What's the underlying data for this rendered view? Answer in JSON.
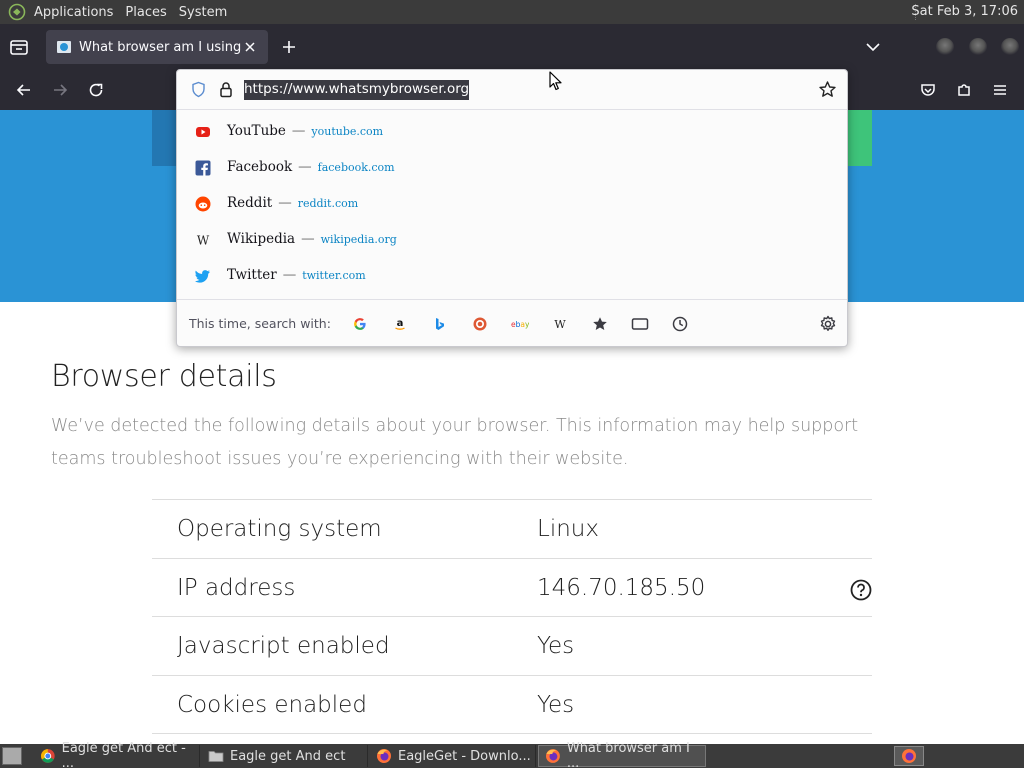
{
  "top_panel": {
    "menus": [
      "Applications",
      "Places",
      "System"
    ],
    "clock": "Sat Feb  3, 17:06"
  },
  "browser": {
    "tab": {
      "title": "What browser am I using?"
    },
    "urlbar": {
      "url": "https://www.whatsmybrowser.org",
      "suggestions": [
        {
          "name": "YouTube",
          "domain": "youtube.com",
          "icon": "youtube-icon"
        },
        {
          "name": "Facebook",
          "domain": "facebook.com",
          "icon": "facebook-icon"
        },
        {
          "name": "Reddit",
          "domain": "reddit.com",
          "icon": "reddit-icon"
        },
        {
          "name": "Wikipedia",
          "domain": "wikipedia.org",
          "icon": "wikipedia-icon"
        },
        {
          "name": "Twitter",
          "domain": "twitter.com",
          "icon": "twitter-icon"
        }
      ],
      "search_with_label": "This time, search with:",
      "engines": [
        "google-icon",
        "amazon-icon",
        "bing-icon",
        "duckduckgo-icon",
        "ebay-icon",
        "wikipedia-icon",
        "bookmarks-icon",
        "tabs-icon",
        "history-icon"
      ]
    }
  },
  "page": {
    "heading": "Browser details",
    "intro": "We’ve detected the following details about your browser. This information may help support teams troubleshoot issues you’re experiencing with their website.",
    "rows": [
      {
        "label": "Operating system",
        "value": "Linux"
      },
      {
        "label": "IP address",
        "value": "146.70.185.50"
      },
      {
        "label": "Javascript enabled",
        "value": "Yes"
      },
      {
        "label": "Cookies enabled",
        "value": "Yes"
      }
    ]
  },
  "taskbar": {
    "tasks": [
      {
        "label": "Eagle get And ect - ...",
        "icon": "chrome-icon"
      },
      {
        "label": "Eagle get And ect",
        "icon": "folder-icon"
      },
      {
        "label": "EagleGet - Downlo...",
        "icon": "firefox-icon"
      },
      {
        "label": "What browser am I ...",
        "icon": "firefox-icon"
      }
    ]
  },
  "colors": {
    "hero_blue": "#2a93d5",
    "firefox_chrome": "#2b2a33",
    "link_blue": "#0b84c4"
  }
}
